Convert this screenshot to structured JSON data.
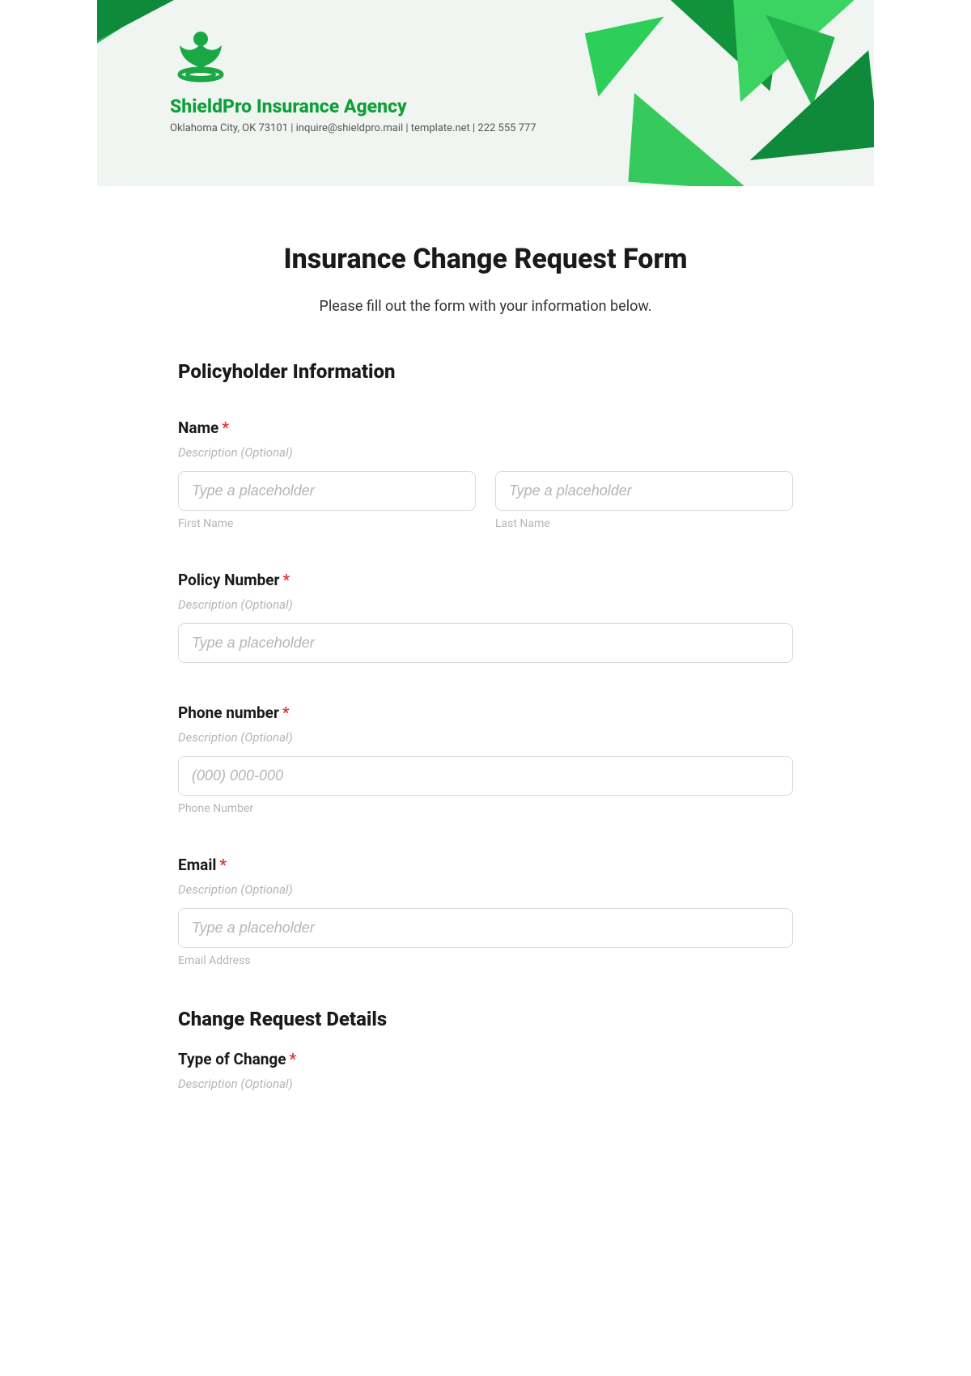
{
  "header": {
    "agency_name": "ShieldPro Insurance Agency",
    "meta": "Oklahoma City, OK 73101 | inquire@shieldpro.mail | template.net | 222 555 777"
  },
  "form": {
    "title": "Insurance Change Request Form",
    "subtitle": "Please fill out the form with your information below.",
    "section1": "Policyholder Information",
    "section2": "Change Request Details",
    "desc_placeholder": "Description (Optional)",
    "generic_placeholder": "Type a placeholder",
    "name": {
      "label": "Name",
      "first_sub": "First Name",
      "last_sub": "Last Name"
    },
    "policy": {
      "label": "Policy Number"
    },
    "phone": {
      "label": "Phone number",
      "value": "(000) 000-000",
      "sub": "Phone Number"
    },
    "email": {
      "label": "Email",
      "sub": "Email Address"
    },
    "change_type": {
      "label": "Type of Change"
    }
  }
}
